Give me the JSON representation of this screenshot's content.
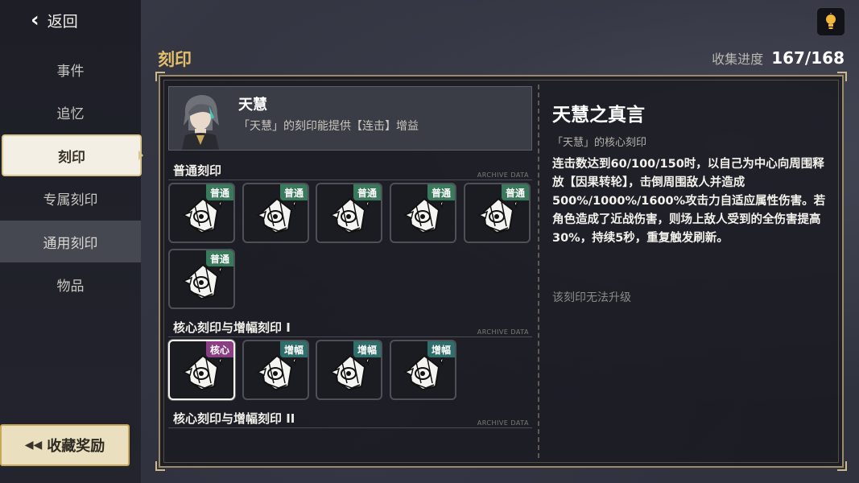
{
  "nav": {
    "back_label": "返回",
    "items": [
      {
        "label": "事件"
      },
      {
        "label": "追忆"
      },
      {
        "label": "刻印"
      },
      {
        "label": "专属刻印"
      },
      {
        "label": "通用刻印"
      },
      {
        "label": "物品"
      }
    ],
    "active": "刻印",
    "reward_button": "收藏奖励"
  },
  "header": {
    "title": "刻印",
    "progress_label": "收集进度",
    "progress_value": "167/168"
  },
  "character": {
    "name": "天慧",
    "description": "「天慧」的刻印能提供【连击】增益"
  },
  "sections": [
    {
      "title": "普通刻印",
      "tag": "ARCHIVE DATA"
    },
    {
      "title": "核心刻印与增幅刻印 I",
      "tag": "ARCHIVE DATA"
    },
    {
      "title": "核心刻印与增幅刻印 II",
      "tag": "ARCHIVE DATA"
    }
  ],
  "tiles": [
    {
      "badge": "普通",
      "badge_color": "#3a7a5c"
    },
    {
      "badge": "普通",
      "badge_color": "#3a7a5c"
    },
    {
      "badge": "普通",
      "badge_color": "#3a7a5c"
    },
    {
      "badge": "普通",
      "badge_color": "#3a7a5c"
    },
    {
      "badge": "普通",
      "badge_color": "#3a7a5c"
    },
    {
      "badge": "普通",
      "badge_color": "#3a7a5c"
    },
    {
      "badge": "核心",
      "badge_color": "#8a3f84"
    },
    {
      "badge": "增幅",
      "badge_color": "#2f6e6a"
    },
    {
      "badge": "增幅",
      "badge_color": "#2f6e6a"
    },
    {
      "badge": "增幅",
      "badge_color": "#2f6e6a"
    }
  ],
  "detail": {
    "title": "天慧之真言",
    "subtitle": "「天慧」的核心刻印",
    "description": "连击数达到60/100/150时，以自己为中心向周围释放【因果转轮】，击倒周围敌人并造成500%/1000%/1600%攻击力自适应属性伤害。若角色造成了近战伤害，则场上敌人受到的全伤害提高30%，持续5秒，重复触发刷新。",
    "note": "该刻印无法升级"
  },
  "colors": {
    "accent_gold": "#e2be6a",
    "badge_normal": "#3a7a5c",
    "badge_core": "#8a3f84",
    "badge_amp": "#2f6e6a"
  }
}
